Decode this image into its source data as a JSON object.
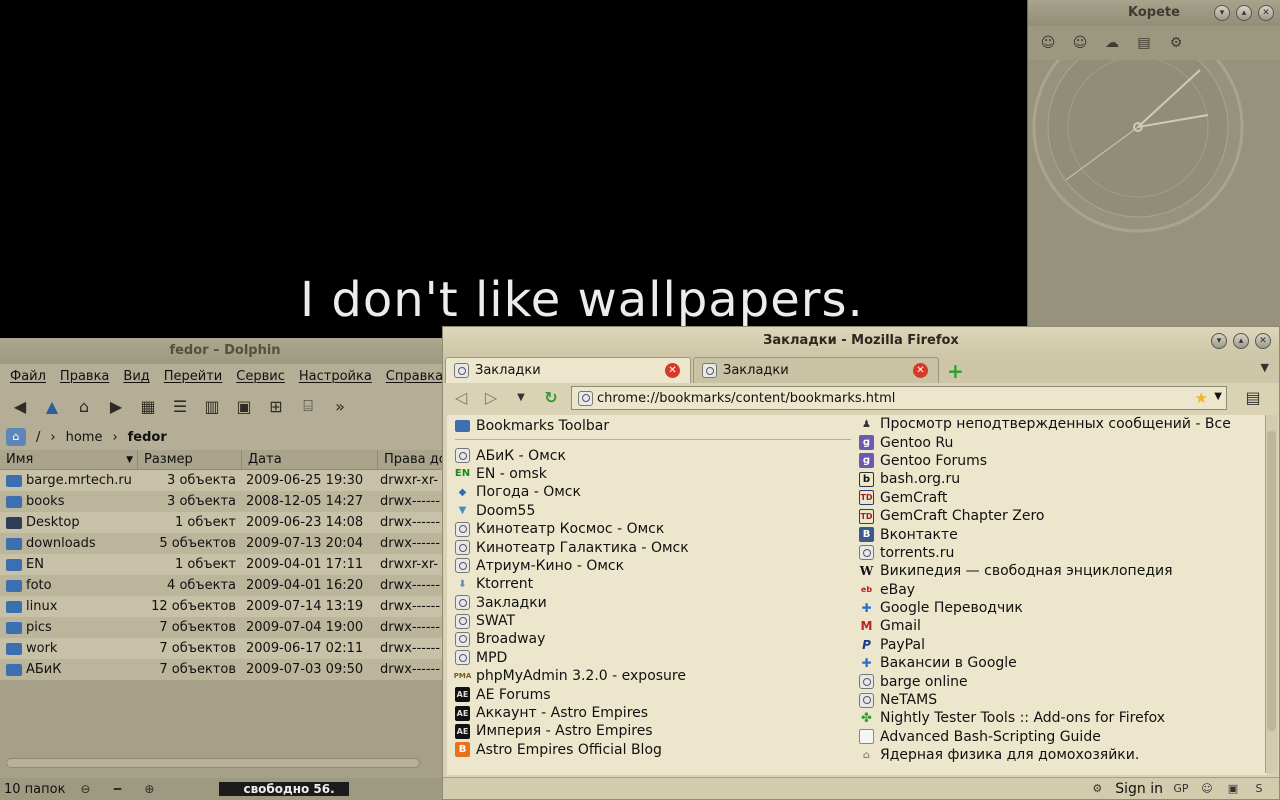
{
  "wallpaper": {
    "text": "I don't like wallpapers."
  },
  "kopete": {
    "title": "Kopete"
  },
  "dolphin": {
    "title": "fedor – Dolphin",
    "menu": [
      "Файл",
      "Правка",
      "Вид",
      "Перейти",
      "Сервис",
      "Настройка",
      "Справка"
    ],
    "breadcrumb": {
      "root": "/",
      "home": "home",
      "current": "fedor"
    },
    "columns": {
      "name": "Имя",
      "size": "Размер",
      "date": "Дата",
      "perm": "Права до"
    },
    "rows": [
      {
        "name": "barge.mrtech.ru",
        "size": "3 объекта",
        "date": "2009-06-25 19:30",
        "perm": "drwxr-xr-"
      },
      {
        "name": "books",
        "size": "3 объекта",
        "date": "2008-12-05 14:27",
        "perm": "drwx------"
      },
      {
        "name": "Desktop",
        "size": "1 объект",
        "date": "2009-06-23 14:08",
        "perm": "drwx------"
      },
      {
        "name": "downloads",
        "size": "5 объектов",
        "date": "2009-07-13 20:04",
        "perm": "drwx------"
      },
      {
        "name": "EN",
        "size": "1 объект",
        "date": "2009-04-01 17:11",
        "perm": "drwxr-xr-"
      },
      {
        "name": "foto",
        "size": "4 объекта",
        "date": "2009-04-01 16:20",
        "perm": "drwx------"
      },
      {
        "name": "linux",
        "size": "12 объектов",
        "date": "2009-07-14 13:19",
        "perm": "drwx------"
      },
      {
        "name": "pics",
        "size": "7 объектов",
        "date": "2009-07-04 19:00",
        "perm": "drwx------"
      },
      {
        "name": "work",
        "size": "7 объектов",
        "date": "2009-06-17 02:11",
        "perm": "drwx------"
      },
      {
        "name": "АБиК",
        "size": "7 объектов",
        "date": "2009-07-03 09:50",
        "perm": "drwx------"
      }
    ],
    "status": {
      "count": "10 папок",
      "free": "свободно 56."
    }
  },
  "firefox": {
    "title": "Закладки - Mozilla Firefox",
    "tabs": [
      "Закладки",
      "Закладки"
    ],
    "url": "chrome://bookmarks/content/bookmarks.html",
    "toolbar_folder": "Bookmarks Toolbar",
    "left_bookmarks": [
      "АБиК - Омск",
      "EN - omsk",
      "Погода - Омск",
      "Doom55",
      "Кинотеатр Космос - Омск",
      "Кинотеатр Галактика - Омск",
      "Атриум-Кино - Омск",
      "Ktorrent",
      "Закладки",
      "SWAT",
      "Broadway",
      "MPD",
      "phpMyAdmin 3.2.0 - exposure",
      "AE Forums",
      "Аккаунт - Astro Empires",
      "Империя - Astro Empires",
      "Astro Empires Official Blog"
    ],
    "right_bookmarks": [
      "Просмотр неподтвержденных сообщений - Все",
      "Gentoo Ru",
      "Gentoo Forums",
      "bash.org.ru",
      "GemCraft",
      "GemCraft Chapter Zero",
      "Вконтакте",
      "torrents.ru",
      "Википедия — свободная энциклопедия",
      "eBay",
      "Google Переводчик",
      "Gmail",
      "PayPal",
      "Вакансии в Google",
      "barge online",
      "NeTAMS",
      "Nightly Tester Tools :: Add-ons for Firefox",
      "Advanced Bash-Scripting Guide",
      "Ядерная физика для домохозяйки."
    ],
    "status": {
      "signin": "Sign in"
    }
  }
}
